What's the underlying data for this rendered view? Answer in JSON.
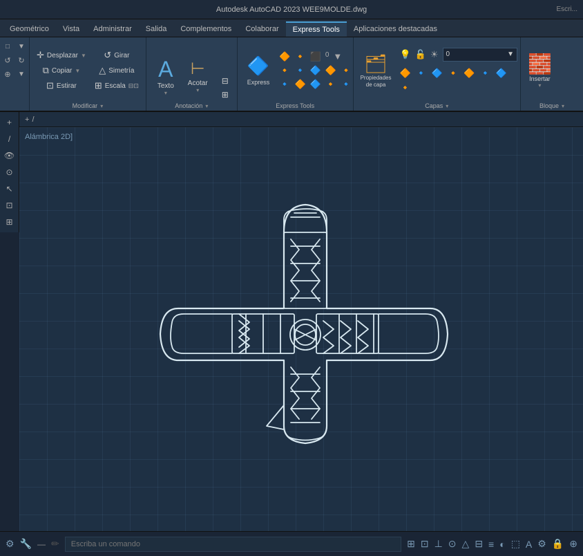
{
  "titlebar": {
    "text": "Autodesk AutoCAD 2023  WEE9MOLDE.dwg",
    "right": "Escri..."
  },
  "ribbon": {
    "tabs": [
      {
        "id": "geometrico",
        "label": "Geométrico",
        "active": false
      },
      {
        "id": "vista",
        "label": "Vista",
        "active": false
      },
      {
        "id": "administrar",
        "label": "Administrar",
        "active": false
      },
      {
        "id": "salida",
        "label": "Salida",
        "active": false
      },
      {
        "id": "complementos",
        "label": "Complementos",
        "active": false
      },
      {
        "id": "colaborar",
        "label": "Colaborar",
        "active": false
      },
      {
        "id": "express",
        "label": "Express Tools",
        "active": true
      },
      {
        "id": "aplicaciones",
        "label": "Aplicaciones destacadas",
        "active": false
      }
    ],
    "groups": {
      "modificar": {
        "label": "Modificar",
        "buttons": [
          {
            "id": "desplazar",
            "label": "Desplazar",
            "icon": "✛"
          },
          {
            "id": "copiar",
            "label": "Copiar",
            "icon": "⧉"
          },
          {
            "id": "estirar",
            "label": "Estirar",
            "icon": "⊡"
          },
          {
            "id": "girar",
            "label": "Girar",
            "icon": "↺"
          },
          {
            "id": "simetria",
            "label": "Simetría",
            "icon": "⇔"
          },
          {
            "id": "escala",
            "label": "Escala",
            "icon": "⊞"
          }
        ]
      },
      "anotacion": {
        "label": "Anotación",
        "texto_label": "Texto",
        "acotar_label": "Acotar"
      },
      "capas": {
        "label": "Capas",
        "layer_name": "0",
        "propiedades_label": "Propiedades\nde capa"
      },
      "bloque": {
        "label": "Bloque",
        "insertar_label": "Insertar"
      }
    }
  },
  "breadcrumb": {
    "separator": "/",
    "text": "/"
  },
  "view_label": "Alámbrica 2D]",
  "canvas": {
    "description": "CAD drawing of a cross-shaped mold piece"
  },
  "status_bar": {
    "placeholder": "Escriba un comando",
    "icons": [
      "⚙",
      "🔧",
      "📐"
    ]
  }
}
